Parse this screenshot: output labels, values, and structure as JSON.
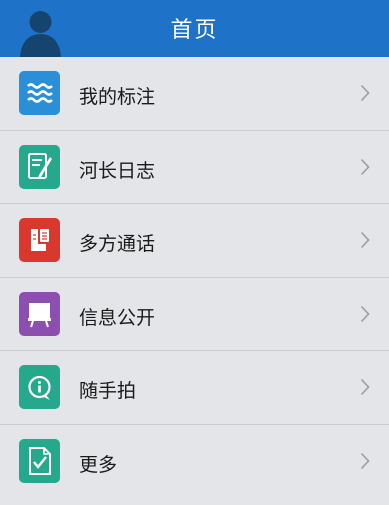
{
  "header": {
    "title": "首页",
    "color": "#1e73c8",
    "avatar_icon": "user-silhouette-icon"
  },
  "menu": {
    "items": [
      {
        "label": "我的标注",
        "icon": "waves-icon",
        "color": "#2a8fd6"
      },
      {
        "label": "河长日志",
        "icon": "notebook-pen-icon",
        "color": "#25a88b"
      },
      {
        "label": "多方通话",
        "icon": "phone-icon",
        "color": "#d8382e"
      },
      {
        "label": "信息公开",
        "icon": "presentation-board-icon",
        "color": "#8c4fb0"
      },
      {
        "label": "随手拍",
        "icon": "camera-info-icon",
        "color": "#25a88b"
      },
      {
        "label": "更多",
        "icon": "document-check-icon",
        "color": "#25a88b"
      }
    ]
  }
}
